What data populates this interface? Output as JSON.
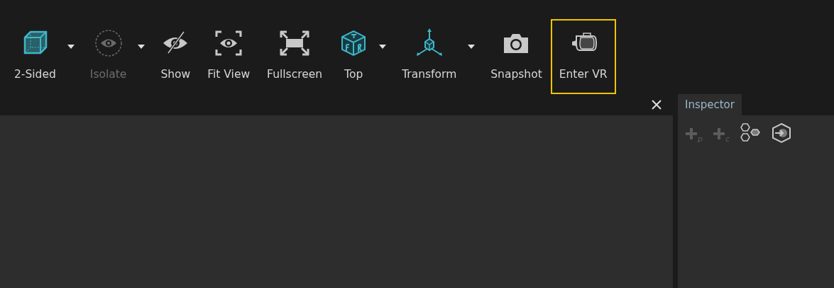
{
  "toolbar": {
    "tools": [
      {
        "label": "2-Sided",
        "disabled": false,
        "dropdown": true,
        "highlighted": false
      },
      {
        "label": "Isolate",
        "disabled": true,
        "dropdown": true,
        "highlighted": false
      },
      {
        "label": "Show",
        "disabled": false,
        "dropdown": false,
        "highlighted": false
      },
      {
        "label": "Fit View",
        "disabled": false,
        "dropdown": false,
        "highlighted": false
      },
      {
        "label": "Fullscreen",
        "disabled": false,
        "dropdown": false,
        "highlighted": false
      },
      {
        "label": "Top",
        "disabled": false,
        "dropdown": true,
        "highlighted": false
      },
      {
        "label": "Transform",
        "disabled": false,
        "dropdown": true,
        "highlighted": false
      },
      {
        "label": "Snapshot",
        "disabled": false,
        "dropdown": false,
        "highlighted": false
      },
      {
        "label": "Enter VR",
        "disabled": false,
        "dropdown": false,
        "highlighted": true
      }
    ]
  },
  "inspector": {
    "tabs": [
      {
        "label": "Inspector",
        "selected": true
      }
    ],
    "tools": [
      {
        "kind": "add",
        "sub": "p",
        "disabled": true
      },
      {
        "kind": "add",
        "sub": "c",
        "disabled": true
      },
      {
        "kind": "nodes",
        "disabled": false
      },
      {
        "kind": "enter",
        "disabled": false
      }
    ]
  }
}
